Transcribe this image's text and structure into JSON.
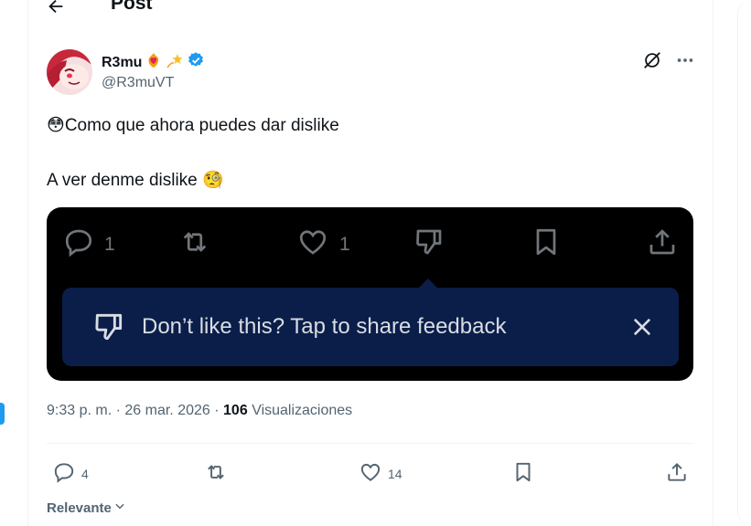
{
  "header": {
    "title": "Post"
  },
  "author": {
    "name": "R3mu",
    "handle": "@R3muVT"
  },
  "post": {
    "line1": "Como que ahora puedes dar dislike",
    "line2": "A ver denme dislike",
    "emoji1": "😳",
    "emoji2": "🧐"
  },
  "media": {
    "reply_count": "1",
    "like_count": "1",
    "tooltip": "Don’t like this? Tap to share feedback"
  },
  "meta": {
    "time": "9:33 p. m.",
    "date": "26 mar. 2026",
    "views_count": "106",
    "views_label": "Visualizaciones",
    "sep": "·"
  },
  "actions": {
    "replies": "4",
    "likes": "14"
  },
  "sort": {
    "label": "Relevante"
  },
  "colors": {
    "accent": "#1d9bf0",
    "tooltip_bg": "#0b1e4a",
    "muted": "#536471"
  }
}
